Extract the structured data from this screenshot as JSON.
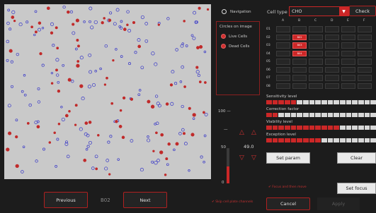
{
  "colors": {
    "accent": "#cc2727",
    "live_circle": "#3636c8",
    "dead_circle": "#c02a2a",
    "image_bg": "#c9c9c9",
    "panel_bg": "#1c1c1c"
  },
  "navigation": {
    "label": "Navigation",
    "selected": false
  },
  "circles_panel": {
    "title": "Circles on image",
    "live_label": "Live Cells",
    "dead_label": "Dead Cells"
  },
  "focus_scale": {
    "top_label": "100 —",
    "dash": "—",
    "mid_label": "50",
    "bottom_label": "0",
    "value": "49.0",
    "fill_fraction": 0.49
  },
  "bottom_nav": {
    "previous_label": "Previous",
    "well_label": "B02",
    "next_label": "Next",
    "warning_text": "Skip cell plate channels"
  },
  "cell_type": {
    "label": "Cell type",
    "value": "CHO",
    "check_label": "Check"
  },
  "plate": {
    "columns": [
      "A",
      "B",
      "C",
      "D",
      "E",
      "F"
    ],
    "rows": [
      "01",
      "02",
      "03",
      "04",
      "05",
      "06",
      "07",
      "08"
    ],
    "selected": [
      {
        "row": "02",
        "col": "B",
        "label": "B02"
      },
      {
        "row": "03",
        "col": "B",
        "label": "B03"
      },
      {
        "row": "04",
        "col": "B",
        "label": "B04"
      }
    ]
  },
  "sliders": [
    {
      "label": "Sensitivity level",
      "red_segments": 5,
      "total_segments": 18
    },
    {
      "label": "Correction factor",
      "red_segments": 2,
      "total_segments": 18
    },
    {
      "label": "Viability level",
      "red_segments": 12,
      "total_segments": 18
    },
    {
      "label": "Exception level",
      "red_segments": 9,
      "total_segments": 18
    }
  ],
  "buttons": {
    "set_param": "Set param",
    "clear": "Clear",
    "set_focus": "Set focus",
    "cancel": "Cancel",
    "apply": "Apply",
    "focus_hint": "Focus and then move"
  }
}
